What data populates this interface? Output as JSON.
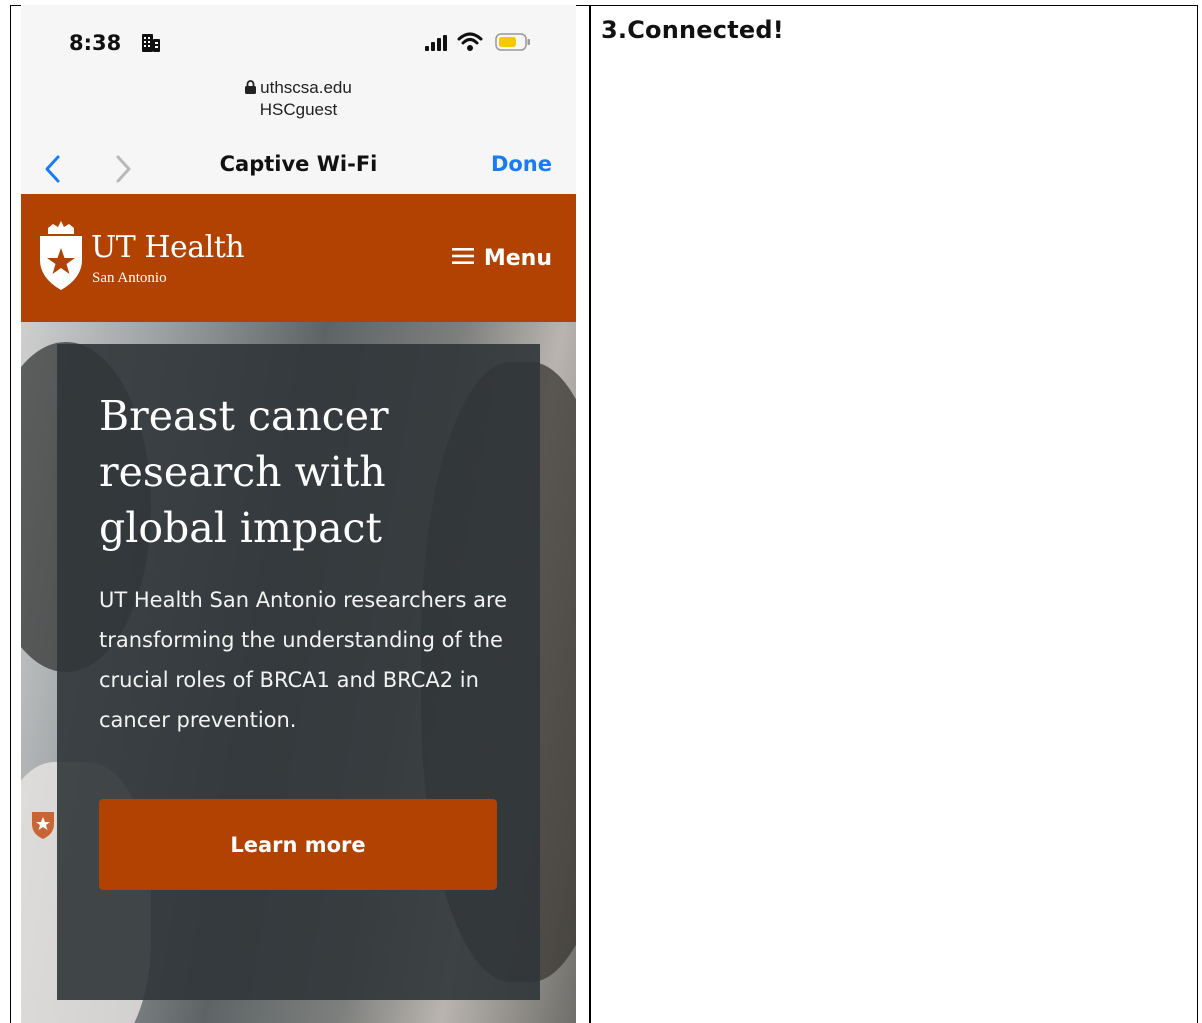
{
  "document": {
    "step_title": "3.Connected!"
  },
  "status_bar": {
    "time": "8:38"
  },
  "url_bar": {
    "domain": "uthscsa.edu",
    "network": "HSCguest"
  },
  "nav_bar": {
    "title": "Captive Wi-Fi",
    "done_label": "Done"
  },
  "site_header": {
    "logo_main": "UT Health",
    "logo_sub": "San Antonio",
    "menu_label": "Menu"
  },
  "hero": {
    "heading": "Breast cancer research with global impact",
    "body": "UT Health San Antonio researchers are transforming the understanding of the crucial roles of BRCA1 and BRCA2 in cancer prevention.",
    "cta_label": "Learn more"
  },
  "colors": {
    "brand_orange": "#b14202",
    "ios_blue": "#1a7cf5",
    "hero_card": "#303538"
  }
}
